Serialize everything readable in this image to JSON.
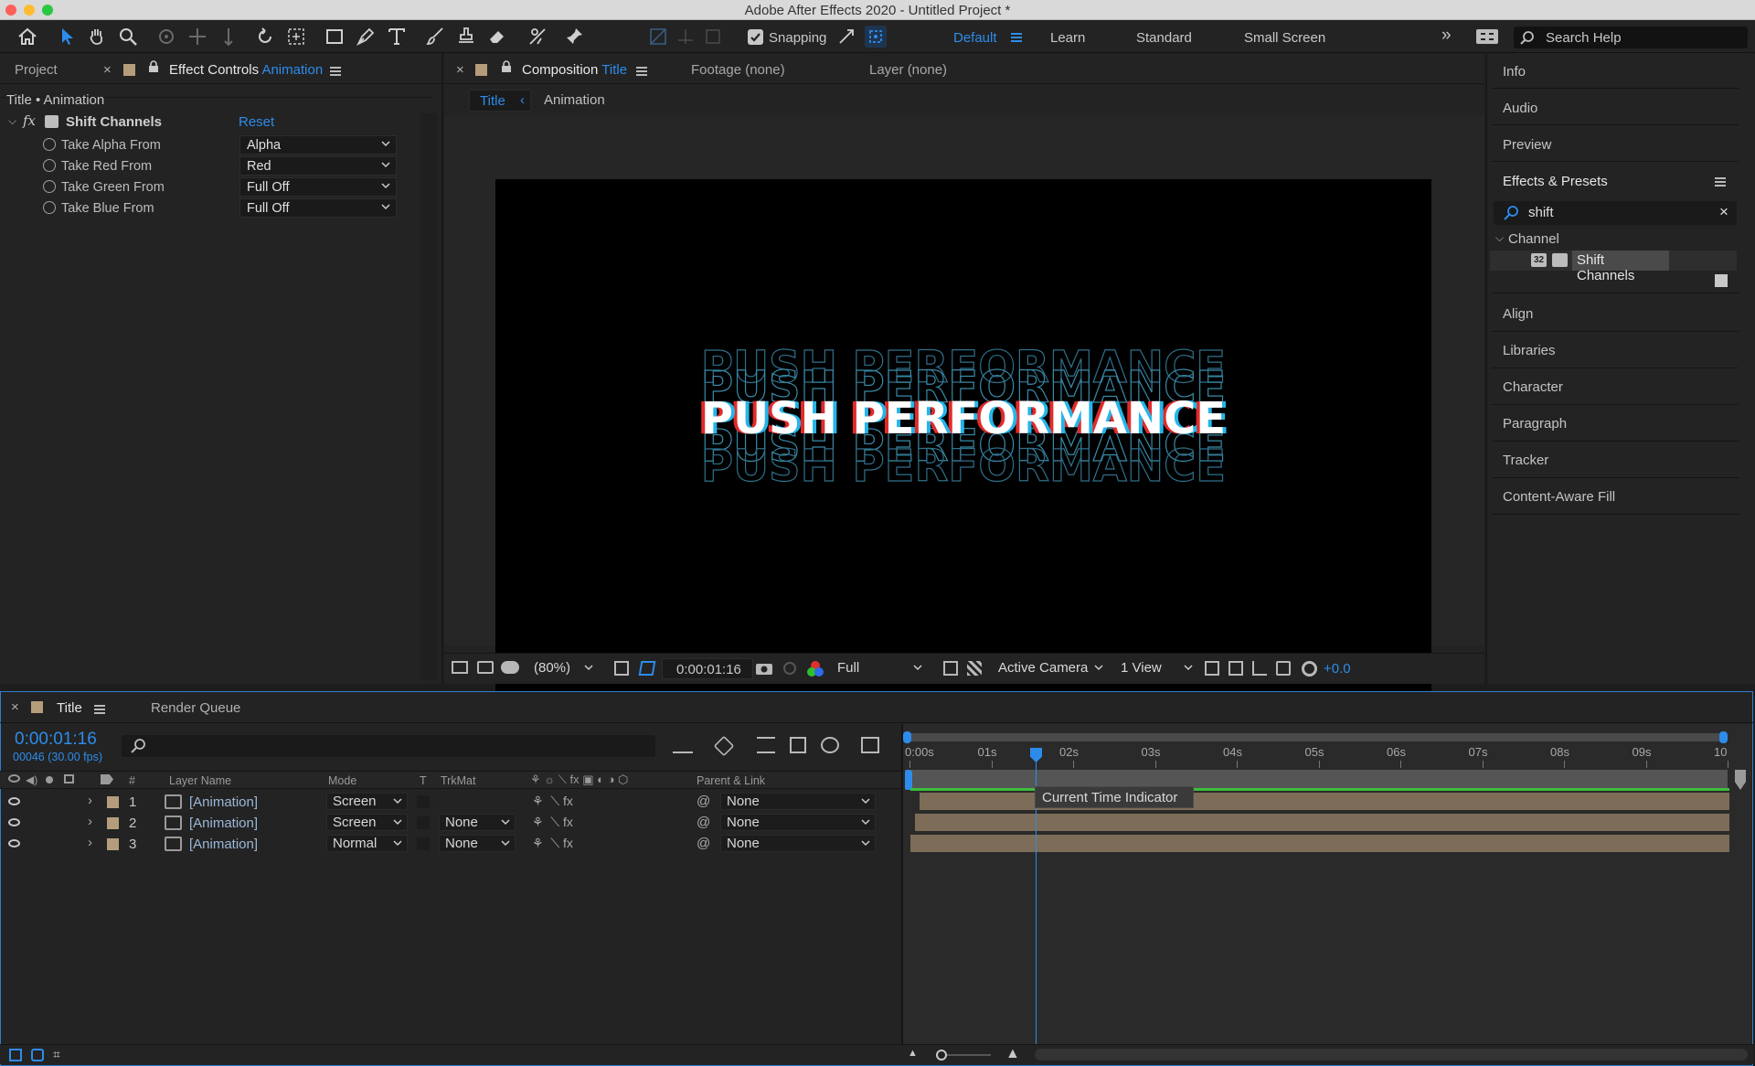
{
  "window": {
    "title": "Adobe After Effects 2020 - Untitled Project *"
  },
  "toolbar": {
    "snapping_label": "Snapping",
    "workspaces": [
      "Default",
      "Learn",
      "Standard",
      "Small Screen"
    ],
    "active_workspace": "Default",
    "search_placeholder": "Search Help"
  },
  "left_panel": {
    "tab_project": "Project",
    "tab_effect_controls": "Effect Controls",
    "tab_effect_controls_target": "Animation",
    "breadcrumb": "Title • Animation",
    "effect": {
      "name": "Shift Channels",
      "reset_label": "Reset",
      "params": [
        {
          "label": "Take Alpha From",
          "value": "Alpha"
        },
        {
          "label": "Take Red From",
          "value": "Red"
        },
        {
          "label": "Take Green From",
          "value": "Full Off"
        },
        {
          "label": "Take Blue From",
          "value": "Full Off"
        }
      ]
    }
  },
  "composition_panel": {
    "tab_composition": "Composition",
    "tab_composition_name": "Title",
    "tab_footage": "Footage (none)",
    "tab_layer": "Layer (none)",
    "breadcrumb_title": "Title",
    "breadcrumb_animation": "Animation",
    "viewer_text": "PUSH PERFORMANCE",
    "footer": {
      "zoom": "(80%)",
      "timecode": "0:00:01:16",
      "resolution": "Full",
      "camera": "Active Camera",
      "views": "1 View",
      "exposure": "+0.0"
    }
  },
  "right_panels": {
    "info": "Info",
    "audio": "Audio",
    "preview": "Preview",
    "effects_presets": "Effects & Presets",
    "search_value": "shift",
    "category": "Channel",
    "result": "Shift Channels",
    "result_badge": "32",
    "align": "Align",
    "libraries": "Libraries",
    "character": "Character",
    "paragraph": "Paragraph",
    "tracker": "Tracker",
    "content_aware_fill": "Content-Aware Fill"
  },
  "timeline": {
    "tab_title": "Title",
    "tab_render_queue": "Render Queue",
    "timecode": "0:00:01:16",
    "frame_info": "00046 (30.00 fps)",
    "columns": {
      "number": "#",
      "layer_name": "Layer Name",
      "mode": "Mode",
      "t": "T",
      "trkmat": "TrkMat",
      "parent": "Parent & Link"
    },
    "layers": [
      {
        "index": "1",
        "name": "[Animation]",
        "mode": "Screen",
        "trkmat": "",
        "parent": "None"
      },
      {
        "index": "2",
        "name": "[Animation]",
        "mode": "Screen",
        "trkmat": "None",
        "parent": "None"
      },
      {
        "index": "3",
        "name": "[Animation]",
        "mode": "Normal",
        "trkmat": "None",
        "parent": "None"
      }
    ],
    "ruler_labels": [
      "0:00s",
      "01s",
      "02s",
      "03s",
      "04s",
      "05s",
      "06s",
      "07s",
      "08s",
      "09s",
      "10"
    ],
    "tooltip": "Current Time Indicator"
  },
  "colors": {
    "accent": "#2d8ceb",
    "layer_label": "#b59d7b",
    "layer_bar": "#7d6c57",
    "work_area": "#3bbf3b"
  }
}
